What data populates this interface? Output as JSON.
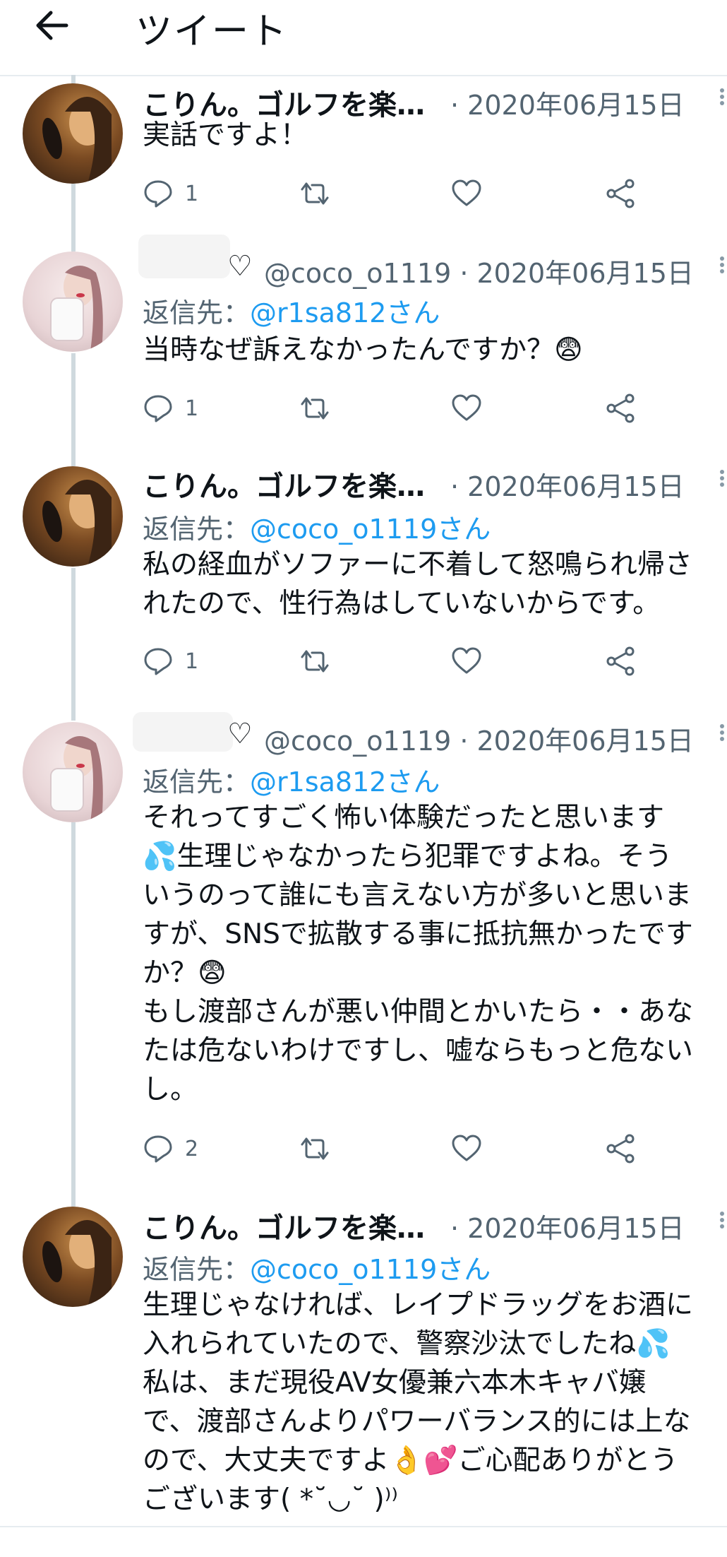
{
  "header": {
    "title": "ツイート"
  },
  "tweets": [
    {
      "name": "こりん。ゴルフを楽…",
      "handle_date": "· 2020年06月15日",
      "body": "実話ですよ！",
      "reply_count": "1"
    },
    {
      "name": "♡",
      "handle_date": "@coco_o1119 · 2020年06月15日",
      "reply_label": "返信先：",
      "reply_target": "@r1sa812さん",
      "body": "当時なぜ訴えなかったんですか？😨",
      "reply_count": "1"
    },
    {
      "name": "こりん。ゴルフを楽…",
      "handle_date": "· 2020年06月15日",
      "reply_label": "返信先：",
      "reply_target": "@coco_o1119さん",
      "body": "私の経血がソファーに不着して怒鳴られ帰さ\nれたので、性行為はしていないからです。",
      "reply_count": "1"
    },
    {
      "name": "♡",
      "handle_date": "@coco_o1119 · 2020年06月15日",
      "reply_label": "返信先：",
      "reply_target": "@r1sa812さん",
      "body": "それってすごく怖い体験だったと思います\n💦生理じゃなかったら犯罪ですよね。そう\nいうのって誰にも言えない方が多いと思いま\nすが、SNSで拡散する事に抵抗無かったです\nか？😨\nもし渡部さんが悪い仲間とかいたら・・あな\nたは危ないわけですし、嘘ならもっと危ない\nし。",
      "reply_count": "2"
    },
    {
      "name": "こりん。ゴルフを楽…",
      "handle_date": "· 2020年06月15日",
      "reply_label": "返信先：",
      "reply_target": "@coco_o1119さん",
      "body": "生理じゃなければ、レイプドラッグをお酒に\n入れられていたので、警察沙汰でしたね💦\n私は、まだ現役AV女優兼六本木キャバ嬢\nで、渡部さんよりパワーバランス的には上な\nので、大丈夫ですよ👌💕ご心配ありがとう\nございます( *˘◡˘ )⁾⁾"
    }
  ],
  "colors": {
    "link": "#1d9bf0",
    "muted": "#536471",
    "icon": "#536471"
  }
}
